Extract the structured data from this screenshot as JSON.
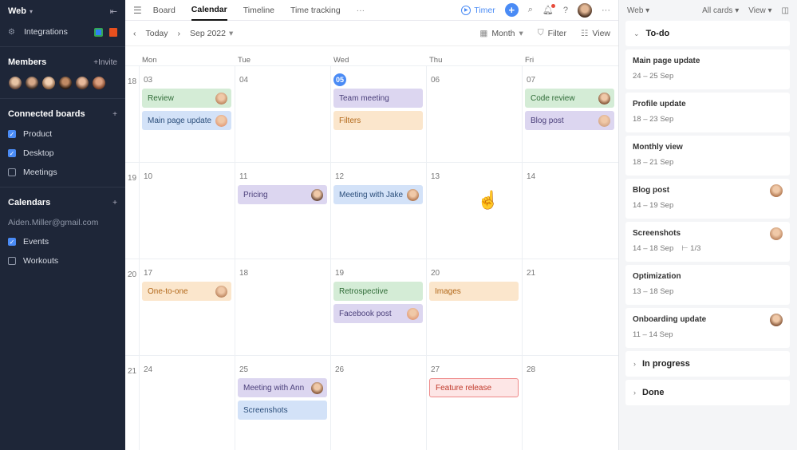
{
  "sidebar": {
    "workspace": "Web",
    "integrations": "Integrations",
    "members_title": "Members",
    "invite": "+Invite",
    "connected_title": "Connected boards",
    "boards": [
      {
        "label": "Product",
        "checked": true
      },
      {
        "label": "Desktop",
        "checked": true
      },
      {
        "label": "Meetings",
        "checked": false
      }
    ],
    "calendars_title": "Calendars",
    "email": "Aiden.Miller@gmail.com",
    "calendars": [
      {
        "label": "Events",
        "checked": true
      },
      {
        "label": "Workouts",
        "checked": false
      }
    ]
  },
  "topbar": {
    "tabs": [
      "Board",
      "Calendar",
      "Timeline",
      "Time tracking"
    ],
    "active_tab": "Calendar",
    "timer": "Timer"
  },
  "subbar": {
    "today": "Today",
    "month_label": "Sep 2022",
    "view_mode": "Month",
    "filter": "Filter",
    "view": "View"
  },
  "calendar": {
    "days_of_week": [
      "Mon",
      "Tue",
      "Wed",
      "Thu",
      "Fri"
    ],
    "weeks": [
      {
        "num": "18",
        "days": [
          {
            "date": "03",
            "events": [
              {
                "label": "Review",
                "color": "green",
                "avatar": true
              },
              {
                "label": "Main page update",
                "color": "blue",
                "avatar": true
              }
            ]
          },
          {
            "date": "04",
            "events": []
          },
          {
            "date": "05",
            "today": true,
            "events": [
              {
                "label": "Team meeting",
                "color": "purple"
              },
              {
                "label": "Filters",
                "color": "orange"
              }
            ]
          },
          {
            "date": "06",
            "events": []
          },
          {
            "date": "07",
            "events": [
              {
                "label": "Code review",
                "color": "green",
                "avatar": true
              },
              {
                "label": "Blog post",
                "color": "purple",
                "avatar": true
              }
            ]
          }
        ]
      },
      {
        "num": "19",
        "days": [
          {
            "date": "10",
            "events": []
          },
          {
            "date": "11",
            "events": [
              {
                "label": "Pricing",
                "color": "purple",
                "avatar": true
              }
            ]
          },
          {
            "date": "12",
            "events": [
              {
                "label": "Meeting with Jake",
                "color": "blue",
                "avatar": true
              }
            ]
          },
          {
            "date": "13",
            "events": []
          },
          {
            "date": "14",
            "events": []
          }
        ]
      },
      {
        "num": "20",
        "days": [
          {
            "date": "17",
            "events": [
              {
                "label": "One-to-one",
                "color": "orange",
                "avatar": true
              }
            ]
          },
          {
            "date": "18",
            "events": []
          },
          {
            "date": "19",
            "events": [
              {
                "label": "Retrospective",
                "color": "green"
              },
              {
                "label": "Facebook post",
                "color": "purple",
                "avatar": true
              }
            ]
          },
          {
            "date": "20",
            "events": [
              {
                "label": "Images",
                "color": "orange"
              }
            ]
          },
          {
            "date": "21",
            "events": []
          }
        ]
      },
      {
        "num": "21",
        "days": [
          {
            "date": "24",
            "events": []
          },
          {
            "date": "25",
            "events": [
              {
                "label": "Meeting with Ann",
                "color": "purple",
                "avatar": true
              },
              {
                "label": "Screenshots",
                "color": "blue"
              }
            ]
          },
          {
            "date": "26",
            "events": []
          },
          {
            "date": "27",
            "events": [
              {
                "label": "Feature release",
                "color": "red"
              }
            ]
          },
          {
            "date": "28",
            "events": []
          }
        ]
      }
    ]
  },
  "right_panel": {
    "board": "Web",
    "filter": "All cards",
    "view": "View",
    "todo_title": "To-do",
    "tasks": [
      {
        "title": "Main page update",
        "dates": "24 – 25 Sep"
      },
      {
        "title": "Profile update",
        "dates": "18 – 23 Sep"
      },
      {
        "title": "Monthly view",
        "dates": "18 – 21 Sep"
      },
      {
        "title": "Blog post",
        "dates": "14 – 19 Sep",
        "avatar": true
      },
      {
        "title": "Screenshots",
        "dates": "14 – 18 Sep",
        "subtasks": "1/3",
        "avatar": true
      },
      {
        "title": "Optimization",
        "dates": "13 – 18 Sep"
      },
      {
        "title": "Onboarding update",
        "dates": "11 – 14 Sep",
        "avatar": true
      }
    ],
    "in_progress": "In progress",
    "done": "Done"
  },
  "colors": {
    "accent": "#4a8bf5",
    "sidebar_bg": "#1e2638"
  }
}
